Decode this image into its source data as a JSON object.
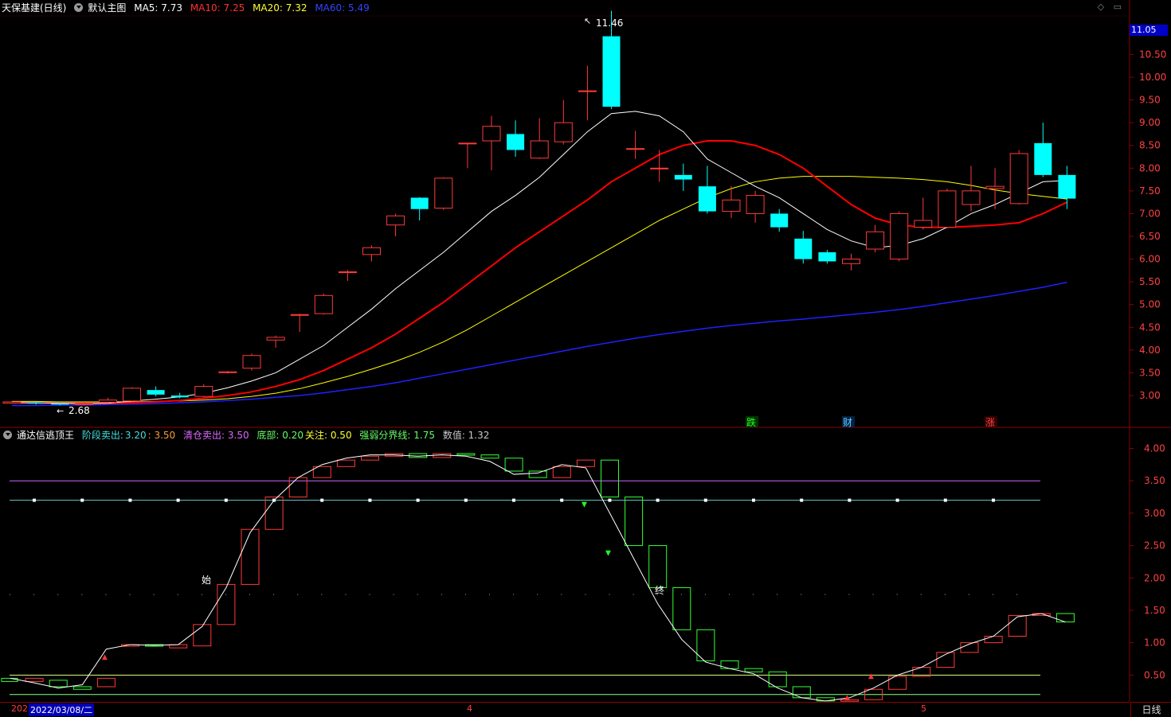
{
  "main_header": {
    "stock": "天保基建(日线)",
    "template": "默认主图",
    "ma5": "MA5: 7.73",
    "ma10": "MA10: 7.25",
    "ma20": "MA20: 7.32",
    "ma60": "MA60: 5.49"
  },
  "indicator_header": {
    "name": "通达信逃顶王",
    "stage_sell_label": "阶段卖出:",
    "stage_sell_v1": "3.20",
    "stage_sell_v2": ": 3.50",
    "clear_sell": "清仓卖出: 3.50",
    "bottom": "底部: 0.20",
    "watch": "关注: 0.50",
    "strength": "强弱分界线: 1.75",
    "value": "数值: 1.32"
  },
  "top_buttons": "◇ ▭",
  "price_tag": "11.05",
  "high_label": "11.46",
  "low_label": "2.68",
  "period_button": "日线",
  "x_axis": {
    "year_fragment": "202",
    "cursor_date": "2022/03/08/二",
    "month_4": "4",
    "month_5": "5"
  },
  "markers": [
    "跌",
    "财",
    "涨"
  ],
  "sub_labels": {
    "start": "始",
    "end": "终"
  },
  "colors": {
    "up": "#ff3a3a",
    "down": "#00ffff",
    "ma5": "#ffffff",
    "ma10": "#ff0000",
    "ma20": "#ffff00",
    "ma60": "#2020ff",
    "border": "#8b0000"
  },
  "chart_data": {
    "type": "candlestick",
    "price_axis": [
      "11.05",
      "10.50",
      "10.00",
      "9.50",
      "9.00",
      "8.50",
      "8.00",
      "7.50",
      "7.00",
      "6.50",
      "6.00",
      "5.50",
      "5.00",
      "4.50",
      "4.00",
      "3.50",
      "3.00"
    ],
    "price_ticks": [
      11.05,
      10.5,
      10.0,
      9.5,
      9.0,
      8.5,
      8.0,
      7.5,
      7.0,
      6.5,
      6.0,
      5.5,
      5.0,
      4.5,
      4.0,
      3.5,
      3.0
    ],
    "candles": [
      [
        2.83,
        2.86,
        2.88,
        2.82
      ],
      [
        2.84,
        2.82,
        2.86,
        2.8
      ],
      [
        2.82,
        2.8,
        2.84,
        2.78
      ],
      [
        2.8,
        2.82,
        2.84,
        2.78
      ],
      [
        2.85,
        2.9,
        2.95,
        2.83
      ],
      [
        2.88,
        3.16,
        3.18,
        2.86
      ],
      [
        3.12,
        3.02,
        3.2,
        2.98
      ],
      [
        3.0,
        2.96,
        3.06,
        2.94
      ],
      [
        2.98,
        3.2,
        3.25,
        2.96
      ],
      [
        3.52,
        3.52,
        3.54,
        3.48
      ],
      [
        3.6,
        3.88,
        3.92,
        3.55
      ],
      [
        4.22,
        4.28,
        4.32,
        4.05
      ],
      [
        4.78,
        4.78,
        4.8,
        4.4
      ],
      [
        4.8,
        5.2,
        5.24,
        4.78
      ],
      [
        5.72,
        5.72,
        5.76,
        5.52
      ],
      [
        6.1,
        6.25,
        6.3,
        5.95
      ],
      [
        6.75,
        6.95,
        7.0,
        6.5
      ],
      [
        7.35,
        7.1,
        7.36,
        6.85
      ],
      [
        7.12,
        7.78,
        7.8,
        7.08
      ],
      [
        8.55,
        8.55,
        8.55,
        8.0
      ],
      [
        8.6,
        8.92,
        9.15,
        7.95
      ],
      [
        8.75,
        8.4,
        9.05,
        8.25
      ],
      [
        8.22,
        8.6,
        9.1,
        8.2
      ],
      [
        8.58,
        9.0,
        9.5,
        8.52
      ],
      [
        9.7,
        9.7,
        10.25,
        9.05
      ],
      [
        10.9,
        9.35,
        11.46,
        9.3
      ],
      [
        8.43,
        8.43,
        8.82,
        8.2
      ],
      [
        8.0,
        8.0,
        8.4,
        7.7
      ],
      [
        7.85,
        7.75,
        8.1,
        7.5
      ],
      [
        7.6,
        7.05,
        8.05,
        7.0
      ],
      [
        7.05,
        7.3,
        7.6,
        6.9
      ],
      [
        7.0,
        7.4,
        7.5,
        6.8
      ],
      [
        7.0,
        6.7,
        7.1,
        6.6
      ],
      [
        6.45,
        6.0,
        6.62,
        5.9
      ],
      [
        6.15,
        5.95,
        6.2,
        5.9
      ],
      [
        5.9,
        6.0,
        6.12,
        5.75
      ],
      [
        6.22,
        6.6,
        6.75,
        6.15
      ],
      [
        6.0,
        7.0,
        7.05,
        5.95
      ],
      [
        6.7,
        6.85,
        7.35,
        6.65
      ],
      [
        6.7,
        7.5,
        7.55,
        6.68
      ],
      [
        7.2,
        7.5,
        8.05,
        7.05
      ],
      [
        7.55,
        7.6,
        8.0,
        7.1
      ],
      [
        7.22,
        8.32,
        8.4,
        7.2
      ],
      [
        8.55,
        7.85,
        9.0,
        7.8
      ],
      [
        7.85,
        7.33,
        8.05,
        7.1
      ]
    ],
    "ma5": [
      2.84,
      2.84,
      2.83,
      2.82,
      2.83,
      2.88,
      2.92,
      2.97,
      3.05,
      3.17,
      3.32,
      3.5,
      3.8,
      4.1,
      4.5,
      4.9,
      5.35,
      5.75,
      6.15,
      6.6,
      7.05,
      7.4,
      7.8,
      8.3,
      8.8,
      9.2,
      9.25,
      9.15,
      8.8,
      8.2,
      7.9,
      7.6,
      7.35,
      7.0,
      6.65,
      6.4,
      6.25,
      6.3,
      6.45,
      6.7,
      7.0,
      7.2,
      7.45,
      7.7,
      7.73
    ],
    "ma10": [
      2.84,
      2.84,
      2.83,
      2.83,
      2.83,
      2.84,
      2.86,
      2.89,
      2.94,
      3.0,
      3.08,
      3.2,
      3.35,
      3.55,
      3.8,
      4.05,
      4.35,
      4.7,
      5.05,
      5.45,
      5.85,
      6.25,
      6.6,
      6.95,
      7.3,
      7.7,
      8.0,
      8.3,
      8.5,
      8.6,
      8.6,
      8.5,
      8.3,
      8.0,
      7.6,
      7.2,
      6.9,
      6.75,
      6.7,
      6.7,
      6.72,
      6.75,
      6.8,
      7.0,
      7.25
    ],
    "ma20": [
      2.87,
      2.87,
      2.86,
      2.86,
      2.86,
      2.86,
      2.87,
      2.88,
      2.9,
      2.93,
      2.98,
      3.05,
      3.15,
      3.28,
      3.42,
      3.58,
      3.75,
      3.95,
      4.18,
      4.45,
      4.75,
      5.05,
      5.35,
      5.65,
      5.95,
      6.25,
      6.55,
      6.85,
      7.1,
      7.35,
      7.55,
      7.7,
      7.78,
      7.82,
      7.82,
      7.82,
      7.8,
      7.78,
      7.75,
      7.7,
      7.62,
      7.52,
      7.44,
      7.38,
      7.32
    ],
    "ma60": [
      2.78,
      2.78,
      2.79,
      2.79,
      2.8,
      2.81,
      2.82,
      2.84,
      2.86,
      2.89,
      2.92,
      2.96,
      3.0,
      3.06,
      3.13,
      3.2,
      3.28,
      3.38,
      3.48,
      3.58,
      3.68,
      3.78,
      3.88,
      3.98,
      4.08,
      4.17,
      4.26,
      4.34,
      4.41,
      4.48,
      4.54,
      4.59,
      4.64,
      4.68,
      4.73,
      4.78,
      4.83,
      4.89,
      4.96,
      5.04,
      5.12,
      5.2,
      5.29,
      5.38,
      5.49
    ],
    "ind_axis": [
      "4.00",
      "3.50",
      "3.00",
      "2.50",
      "2.00",
      "1.50",
      "1.00",
      "0.50"
    ],
    "ind_ticks": [
      4.0,
      3.5,
      3.0,
      2.5,
      2.0,
      1.5,
      1.0,
      0.5
    ],
    "ind_boxes": [
      [
        0.4,
        0.45
      ],
      [
        0.42,
        0.32
      ],
      [
        0.32,
        0.28
      ],
      [
        0.32,
        0.45
      ],
      [
        0.97,
        0.97
      ],
      [
        0.97,
        0.95
      ],
      [
        0.92,
        0.97
      ],
      [
        0.95,
        1.28
      ],
      [
        1.28,
        1.9
      ],
      [
        1.9,
        2.75
      ],
      [
        2.75,
        3.25
      ],
      [
        3.25,
        3.55
      ],
      [
        3.55,
        3.72
      ],
      [
        3.72,
        3.82
      ],
      [
        3.82,
        3.88
      ],
      [
        3.88,
        3.92
      ],
      [
        3.92,
        3.86
      ],
      [
        3.86,
        3.92
      ],
      [
        3.92,
        3.9
      ],
      [
        3.9,
        3.85
      ],
      [
        3.85,
        3.65
      ],
      [
        3.65,
        3.55
      ],
      [
        3.55,
        3.72
      ],
      [
        3.72,
        3.82
      ],
      [
        3.82,
        3.25
      ],
      [
        3.25,
        2.5
      ],
      [
        2.5,
        1.85
      ],
      [
        1.85,
        1.2
      ],
      [
        1.2,
        0.72
      ],
      [
        0.72,
        0.6
      ],
      [
        0.6,
        0.55
      ],
      [
        0.55,
        0.32
      ],
      [
        0.32,
        0.15
      ],
      [
        0.15,
        0.1
      ],
      [
        0.1,
        0.12
      ],
      [
        0.12,
        0.28
      ],
      [
        0.28,
        0.48
      ],
      [
        0.48,
        0.62
      ],
      [
        0.62,
        0.85
      ],
      [
        0.85,
        1.0
      ],
      [
        1.0,
        1.1
      ],
      [
        1.1,
        1.42
      ],
      [
        1.42,
        1.45
      ],
      [
        1.45,
        1.32
      ]
    ],
    "ind_line": [
      0.45,
      0.38,
      0.3,
      0.35,
      0.9,
      0.97,
      0.96,
      0.97,
      1.25,
      1.85,
      2.7,
      3.2,
      3.55,
      3.75,
      3.85,
      3.9,
      3.9,
      3.88,
      3.9,
      3.88,
      3.8,
      3.6,
      3.62,
      3.75,
      3.7,
      3.0,
      2.3,
      1.6,
      1.05,
      0.7,
      0.6,
      0.52,
      0.3,
      0.15,
      0.1,
      0.15,
      0.3,
      0.5,
      0.62,
      0.82,
      0.98,
      1.1,
      1.4,
      1.45,
      1.32
    ],
    "levels": {
      "stage_sell_1": 3.2,
      "stage_sell_2": 3.5,
      "clear_sell": 3.5,
      "bottom": 0.2,
      "watch": 0.5,
      "strength": 1.75
    }
  }
}
